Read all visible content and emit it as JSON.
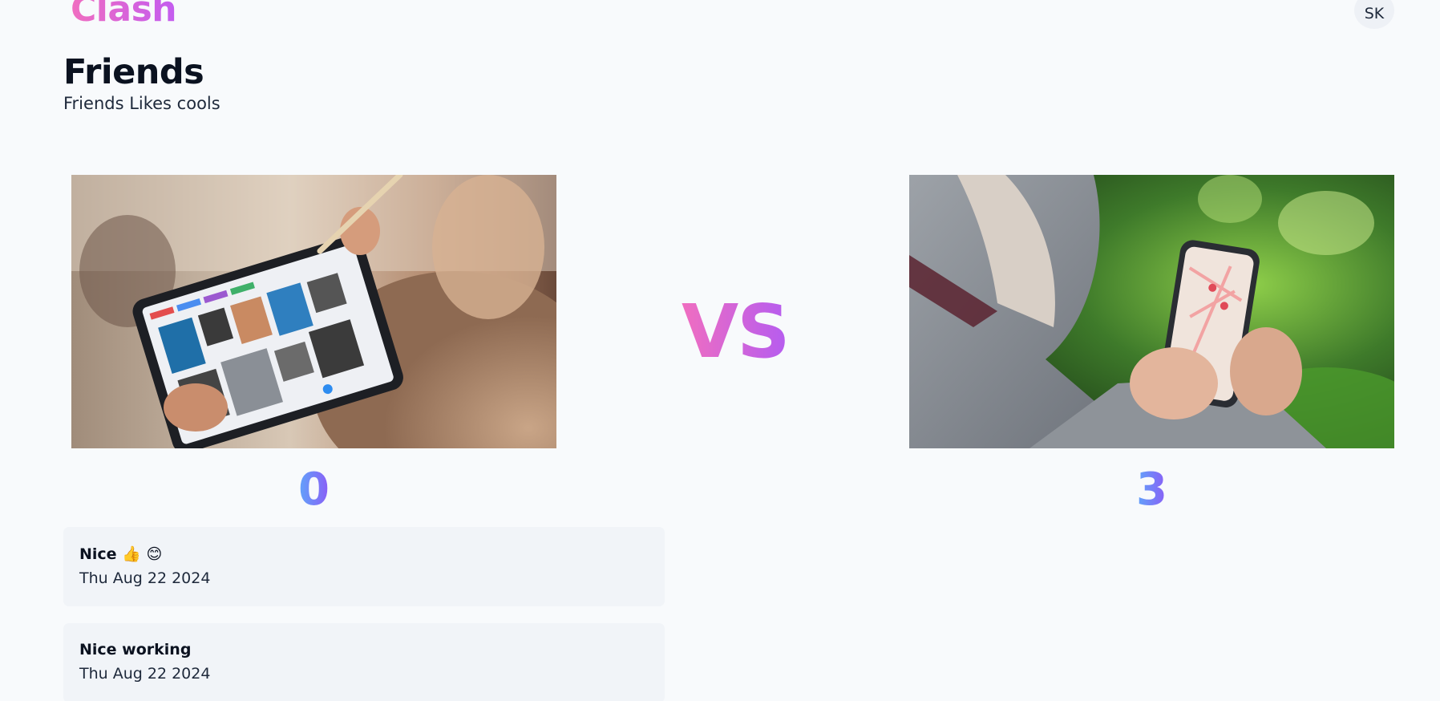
{
  "header": {
    "brand": "Clash",
    "avatar_initials": "SK"
  },
  "clash": {
    "title": "Friends",
    "description": "Friends Likes cools",
    "vs_label": "VS"
  },
  "items": [
    {
      "image_icon": "tablet-photo",
      "votes": "0"
    },
    {
      "image_icon": "phone-photo",
      "votes": "3"
    }
  ],
  "comments": [
    {
      "text": "Nice 👍 😊",
      "date": "Thu Aug 22 2024"
    },
    {
      "text": "Nice working",
      "date": "Thu Aug 22 2024"
    }
  ],
  "colors": {
    "brand_gradient_start": "#f06ec0",
    "brand_gradient_end": "#c35cf0",
    "score_gradient_start": "#60a5fa",
    "score_gradient_end": "#8b5cf6",
    "background": "#f8fafc",
    "comment_bg": "#f1f4f8"
  }
}
